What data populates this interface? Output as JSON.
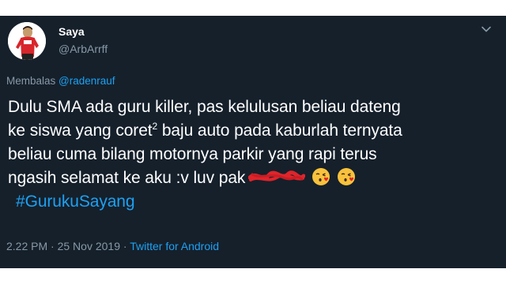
{
  "user": {
    "name": "Saya",
    "handle": "@ArbArrff"
  },
  "reply": {
    "prefix": "Membalas",
    "mention": "@radenrauf"
  },
  "tweet": {
    "line1": "Dulu SMA ada guru killer, pas kelulusan beliau dateng",
    "line2_pre": "ke siswa yang coret",
    "line2_sup": "2",
    "line2_post": " baju auto pada kaburlah ternyata",
    "line3": "beliau cuma bilang motornya parkir yang rapi terus",
    "line4": "ngasih selamat ke aku :v luv pak",
    "hashtag": "#GurukuSayang"
  },
  "meta": {
    "time": "2.22 PM",
    "separator1": " · ",
    "date": "25 Nov 2019",
    "separator2": " · ",
    "source": "Twitter for Android"
  },
  "icons": {
    "chevron": "chevron-down-icon",
    "emoji": "face-blowing-kiss-icon"
  },
  "colors": {
    "background": "#15202b",
    "text": "#ffffff",
    "muted": "#8899a6",
    "link": "#1da1f2"
  }
}
